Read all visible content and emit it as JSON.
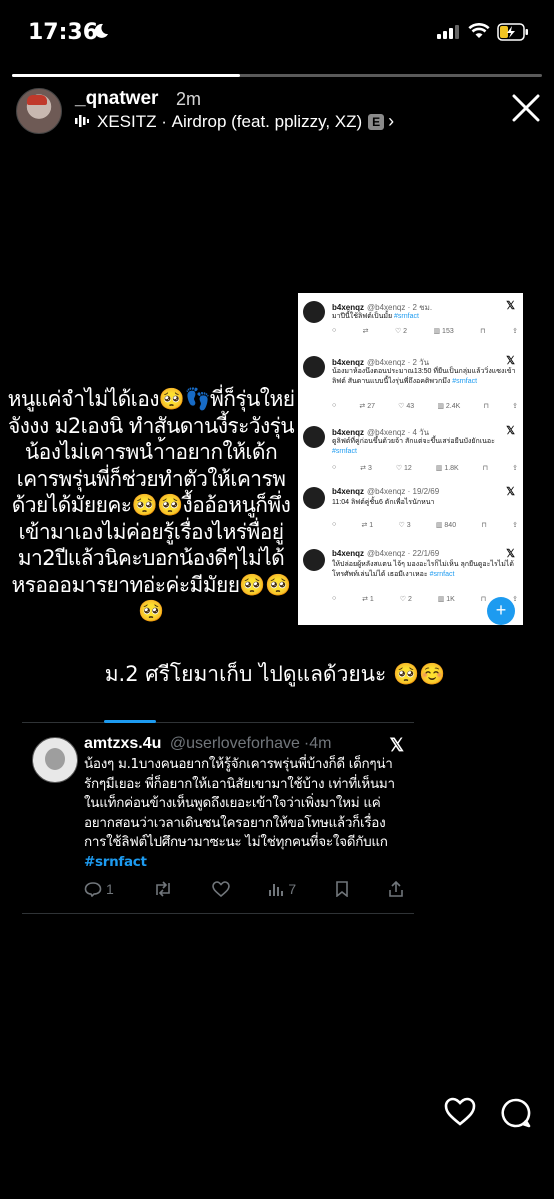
{
  "status_bar": {
    "time": "17:36"
  },
  "story": {
    "username": "_qnatwer",
    "posted_ago": "2m",
    "music": {
      "artist": "XESITZ",
      "title": "Airdrop (feat. pplizzy, XZ)",
      "explicit_badge": "E"
    },
    "progress": 0.43,
    "left_caption": "หนูแค่จำไม่ได้เอง🥺👣พี่ก็รุ่นใหย่จังงง ม2เองนิ ทำสันดานงี้ระวังรุ่นน้องไม่เคารพนำ้าอยากให้เด้กเคารพรุ่นพี่ก็ช่วยทำตัวให้เคารพด้วยได้มัยยคะ🥺🥺งื้ออ้อหนูก็พึ่งเข้ามาเองไม่ค่อยรู้เรื่องไหร่พื่อยู่มา2ปีแล้วนิคะบอกน้องดีๆไม่ได้หรอออมารยาทอ่ะค่ะมีมัยย🥺🥺🥺",
    "mid_caption": "ม.2 ศรีโยมาเก็บ ไปดูแลด้วยนะ 🥺☺️"
  },
  "screenshot_tweets": [
    {
      "name": "b4xenqz",
      "handle": "@b4xenqz",
      "time": "2 ชม.",
      "text": "มาปีนี้ใช้ลิฟต์เป็นมั้ย",
      "tag": "#srnfact",
      "replies": "",
      "retweets": "",
      "likes": "2",
      "views": "153"
    },
    {
      "name": "b4xenqz",
      "handle": "@b4xenqz",
      "time": "2 วัน",
      "text": "น้องมาห้องนึงตอนประมาณ13:50 ที่ยืนเป็นกลุ่มแล้ววิ่งแซงเข้าลิฟต์ สันดานแบบนี้ไงรุ่นพี่ถึงอคติพวกมึง",
      "tag": "#srnfact",
      "replies": "",
      "retweets": "27",
      "likes": "43",
      "views": "2.4K"
    },
    {
      "name": "b4xenqz",
      "handle": "@b4xenqz",
      "time": "4 วัน",
      "text": "ดูลิฟต์ที่คู่ก่อนขึ้นด้วยจ้า สักแต่จะขึ้นเสร่อยืนบังยักเนอะ",
      "tag": "#srnfact",
      "replies": "",
      "retweets": "3",
      "likes": "12",
      "views": "1.8K"
    },
    {
      "name": "b4xenqz",
      "handle": "@b4xenqz",
      "time": "19/2/69",
      "text": "11:04 ลิฟต์คู่ชั้น6 ตักเพื่อไรนักหนา",
      "tag": "",
      "replies": "",
      "retweets": "1",
      "likes": "3",
      "views": "840"
    },
    {
      "name": "b4xenqz",
      "handle": "@b4xenqz",
      "time": "22/1/69",
      "text": "ให้ปล่อยผู้หลังสแตน ไจ้ๆ มองอะไรก็ไม่เห็น ลุกยืนดูอะไรไม่ได้ โทรศัพท์เล่นไม่ได้ เธอมีเงาเหอะ",
      "tag": "#srnfact",
      "replies": "",
      "retweets": "1",
      "likes": "2",
      "views": "1K"
    }
  ],
  "fab_label": "+",
  "big_tweet": {
    "name": "amtzxs.4u",
    "handle": "@userloveforhave",
    "time": "4m",
    "text": "น้องๆ ม.1บางคนอยากให้รู้จักเคารพรุ่นพี่บ้างก็ดี เด็กๆน่ารักๆมีเยอะ พี่ก็อยากให้เอานิสัยเขามาใช้บ้าง เท่าที่เห็นมาในแท็กค่อนข้างเห็นพูดถึงเยอะเข้าใจว่าเพิ่งมาใหม่ แค่อยากสอนว่าเวลาเดินชนใครอยากให้ขอโทษแล้วก็เรื่องการใช้ลิฟต์ไปศึกษามาซะนะ ไม่ใช่ทุกคนที่จะใจดีกับแก",
    "tag": "#srnfact",
    "replies": "1",
    "views": "7"
  }
}
